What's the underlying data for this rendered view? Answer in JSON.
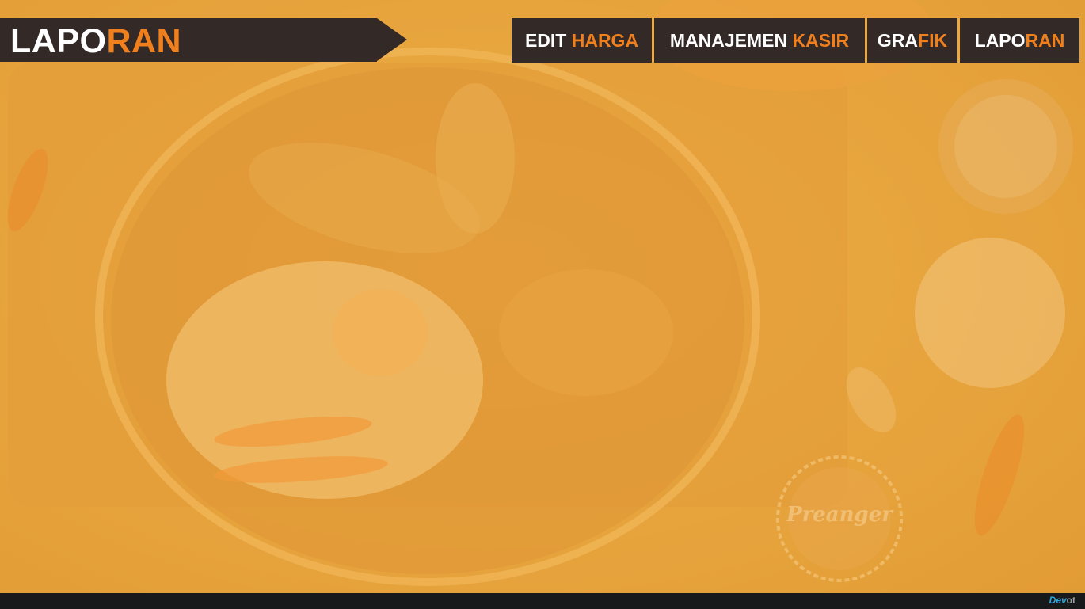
{
  "page_title": {
    "part1": "LAPO",
    "part2": "RAN"
  },
  "nav": [
    {
      "w": "EDIT ",
      "o": "HARGA"
    },
    {
      "w": "MANAJEMEN ",
      "o": "KASIR"
    },
    {
      "w": "GRA",
      "o": "FIK"
    },
    {
      "w": "LAPO",
      "o": "RAN"
    }
  ],
  "watermark": {
    "text": "Preanger"
  },
  "footer": {
    "brand_part1": "Dev",
    "brand_part2": "ot"
  },
  "colors": {
    "accent": "#f07f1e",
    "bar": "#332a28",
    "background": "#e8a23c",
    "footer": "#17191a"
  }
}
